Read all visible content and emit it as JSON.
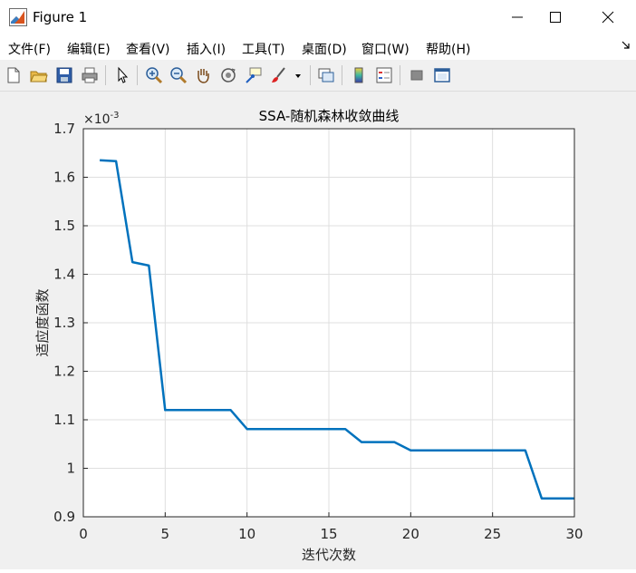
{
  "window": {
    "title": "Figure 1"
  },
  "menu": [
    "文件(F)",
    "编辑(E)",
    "查看(V)",
    "插入(I)",
    "工具(T)",
    "桌面(D)",
    "窗口(W)",
    "帮助(H)"
  ],
  "toolbar": {
    "icons": [
      "new-figure-icon",
      "open-file-icon",
      "save-icon",
      "print-icon",
      "select-arrow-icon",
      "zoom-in-icon",
      "zoom-out-icon",
      "pan-icon",
      "rotate-3d-icon",
      "data-cursor-icon",
      "brush-icon",
      "brush-dropdown-icon",
      "link-plot-icon",
      "insert-colorbar-icon",
      "insert-legend-icon",
      "hide-plot-tools-icon",
      "show-plot-tools-icon"
    ]
  },
  "chart_data": {
    "type": "line",
    "title": "SSA-随机森林收敛曲线",
    "xlabel": "迭代次数",
    "ylabel": "适应度函数",
    "exponent_label": "×10",
    "exponent_power": "-3",
    "xlim": [
      0,
      30
    ],
    "ylim": [
      0.9,
      1.7
    ],
    "xticks": [
      "0",
      "5",
      "10",
      "15",
      "20",
      "25",
      "30"
    ],
    "yticks": [
      "0.9",
      "1",
      "1.1",
      "1.2",
      "1.3",
      "1.4",
      "1.5",
      "1.6",
      "1.7"
    ],
    "grid": true,
    "color": "#0072BD",
    "series": [
      {
        "x": [
          1,
          2,
          3,
          4,
          5,
          6,
          7,
          8,
          9,
          10,
          11,
          12,
          13,
          14,
          15,
          16,
          17,
          18,
          19,
          20,
          21,
          22,
          23,
          24,
          25,
          26,
          27,
          28,
          29,
          30
        ],
        "values": [
          1.635,
          1.633,
          1.425,
          1.418,
          1.12,
          1.12,
          1.12,
          1.12,
          1.12,
          1.081,
          1.081,
          1.081,
          1.081,
          1.081,
          1.081,
          1.081,
          1.054,
          1.054,
          1.054,
          1.037,
          1.037,
          1.037,
          1.037,
          1.037,
          1.037,
          1.037,
          1.037,
          0.938,
          0.938,
          0.938
        ]
      }
    ]
  }
}
